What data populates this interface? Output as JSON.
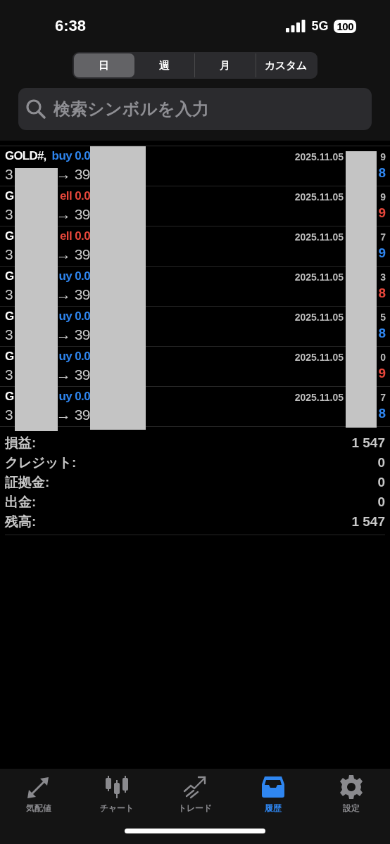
{
  "status_bar": {
    "time": "6:38",
    "network": "5G",
    "battery": "100"
  },
  "period_tabs": [
    {
      "label": "日",
      "selected": true
    },
    {
      "label": "週",
      "selected": false
    },
    {
      "label": "月",
      "selected": false
    },
    {
      "label": "カスタム",
      "selected": false
    }
  ],
  "search": {
    "placeholder": "検索シンボルを入力"
  },
  "deals": [
    {
      "symbol": "GOLD#,",
      "side": {
        "text": "buy 0.0",
        "color": "#2f86f0"
      },
      "open_price": "3",
      "close_price": "→ 39",
      "date": "2025.11.05",
      "time": "9",
      "profit": {
        "text": "8",
        "color": "#2f86f0"
      }
    },
    {
      "symbol": "G",
      "side": {
        "text": "ell 0.0",
        "color": "#e8473b"
      },
      "open_price": "3",
      "close_price": "→ 39",
      "date": "2025.11.05",
      "time": "9",
      "profit": {
        "text": "9",
        "color": "#e8473b"
      }
    },
    {
      "symbol": "G",
      "side": {
        "text": "ell 0.0",
        "color": "#e8473b"
      },
      "open_price": "3",
      "close_price": "→ 39",
      "date": "2025.11.05",
      "time": "7",
      "profit": {
        "text": "9",
        "color": "#2f86f0"
      }
    },
    {
      "symbol": "G",
      "side": {
        "text": "uy 0.0",
        "color": "#2f86f0"
      },
      "open_price": "3",
      "close_price": "→ 39",
      "date": "2025.11.05",
      "time": "3",
      "profit": {
        "text": "8",
        "color": "#e8473b"
      }
    },
    {
      "symbol": "G",
      "side": {
        "text": "uy 0.0",
        "color": "#2f86f0"
      },
      "open_price": "3",
      "close_price": "→ 39",
      "date": "2025.11.05",
      "time": "5",
      "profit": {
        "text": "8",
        "color": "#2f86f0"
      }
    },
    {
      "symbol": "G",
      "side": {
        "text": "uy 0.0",
        "color": "#2f86f0"
      },
      "open_price": "3",
      "close_price": "→ 39",
      "date": "2025.11.05",
      "time": "0",
      "profit": {
        "text": "9",
        "color": "#e8473b"
      }
    },
    {
      "symbol": "G",
      "side": {
        "text": "uy 0.0",
        "color": "#2f86f0"
      },
      "open_price": "3",
      "close_price": "→ 39",
      "date": "2025.11.05",
      "time": "7",
      "profit": {
        "text": "8",
        "color": "#2f86f0"
      }
    }
  ],
  "summary": [
    {
      "label": "損益:",
      "value": "1 547"
    },
    {
      "label": "クレジット:",
      "value": "0"
    },
    {
      "label": "証拠金:",
      "value": "0"
    },
    {
      "label": "出金:",
      "value": "0"
    },
    {
      "label": "残高:",
      "value": "1 547"
    }
  ],
  "bottom_tabs": [
    {
      "label": "気配値",
      "kind": "quotes",
      "selected": false
    },
    {
      "label": "チャート",
      "kind": "chart",
      "selected": false
    },
    {
      "label": "トレード",
      "kind": "trade",
      "selected": false
    },
    {
      "label": "履歴",
      "kind": "history",
      "selected": true
    },
    {
      "label": "設定",
      "kind": "settings",
      "selected": false
    }
  ]
}
